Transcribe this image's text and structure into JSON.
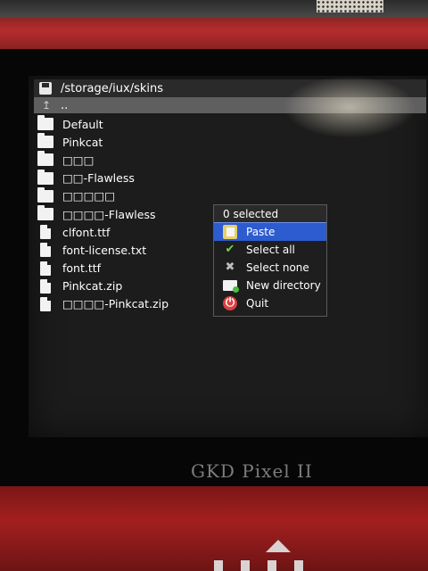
{
  "window": {
    "path": "/storage/iux/skins",
    "parent": ".."
  },
  "files": [
    {
      "name": "Default",
      "icon": "folder-icon"
    },
    {
      "name": "Pinkcat",
      "icon": "folder-icon"
    },
    {
      "name": "□□□",
      "icon": "folder-icon"
    },
    {
      "name": "□□-Flawless",
      "icon": "folder-icon"
    },
    {
      "name": "□□□□□",
      "icon": "folder-icon"
    },
    {
      "name": "□□□□-Flawless",
      "icon": "folder-icon"
    },
    {
      "name": "clfont.ttf",
      "icon": "file-icon"
    },
    {
      "name": "font-license.txt",
      "icon": "file-icon"
    },
    {
      "name": "font.ttf",
      "icon": "file-icon"
    },
    {
      "name": "Pinkcat.zip",
      "icon": "file-icon"
    },
    {
      "name": "□□□□-Pinkcat.zip",
      "icon": "file-icon"
    }
  ],
  "menu": {
    "header": "0 selected",
    "items": [
      {
        "label": "Paste",
        "icon": "paste-icon",
        "selected": true
      },
      {
        "label": "Select all",
        "icon": "checkmark-icon"
      },
      {
        "label": "Select none",
        "icon": "x-icon"
      },
      {
        "label": "New directory",
        "icon": "new-folder-icon"
      },
      {
        "label": "Quit",
        "icon": "power-icon"
      }
    ]
  },
  "device": {
    "brand": "GKD Pixel II"
  },
  "colors": {
    "selection": "#2d5bd0",
    "background": "#1c1c1c",
    "header": "#2a2a2a",
    "parent_row": "#5f5f5f"
  }
}
